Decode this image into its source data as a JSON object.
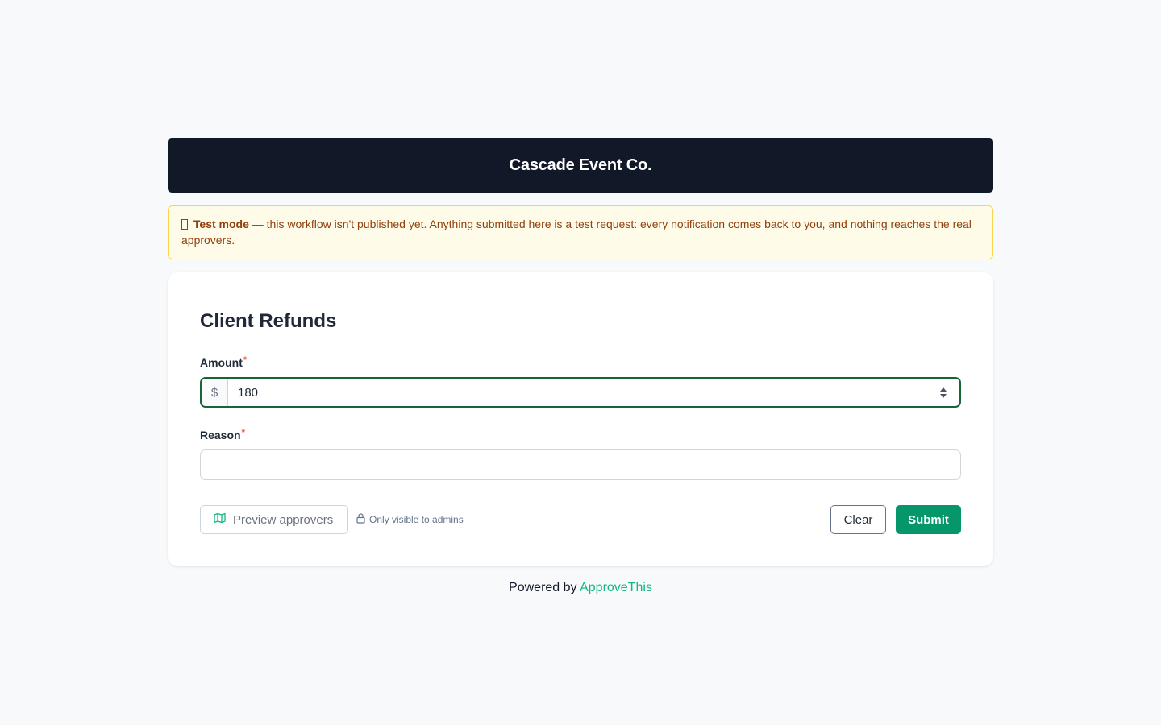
{
  "header": {
    "title": "Cascade Event Co."
  },
  "banner": {
    "icon": "unknown-glyph-icon",
    "label": "Test mode",
    "message": " — this workflow isn't published yet. Anything submitted here is a test request: every notification comes back to you, and nothing reaches the real approvers."
  },
  "form": {
    "title": "Client Refunds",
    "fields": [
      {
        "label": "Amount",
        "required_mark": "*",
        "prefix": "$",
        "value": "180"
      },
      {
        "label": "Reason",
        "required_mark": "*",
        "value": "",
        "placeholder": ""
      }
    ]
  },
  "actions": {
    "preview_label": "Preview approvers",
    "preview_icon": "map-icon",
    "admin_note": "Only visible to admins",
    "admin_icon": "lock-icon",
    "clear_label": "Clear",
    "submit_label": "Submit"
  },
  "footer": {
    "prefix": "Powered by",
    "brand": "ApproveThis"
  },
  "colors": {
    "header_bg": "#111827",
    "banner_bg": "#fefce8",
    "banner_text": "#92400e",
    "focus_border": "#166534",
    "submit_bg": "#059669",
    "brand_link": "#10b981",
    "required": "#ef4444"
  }
}
